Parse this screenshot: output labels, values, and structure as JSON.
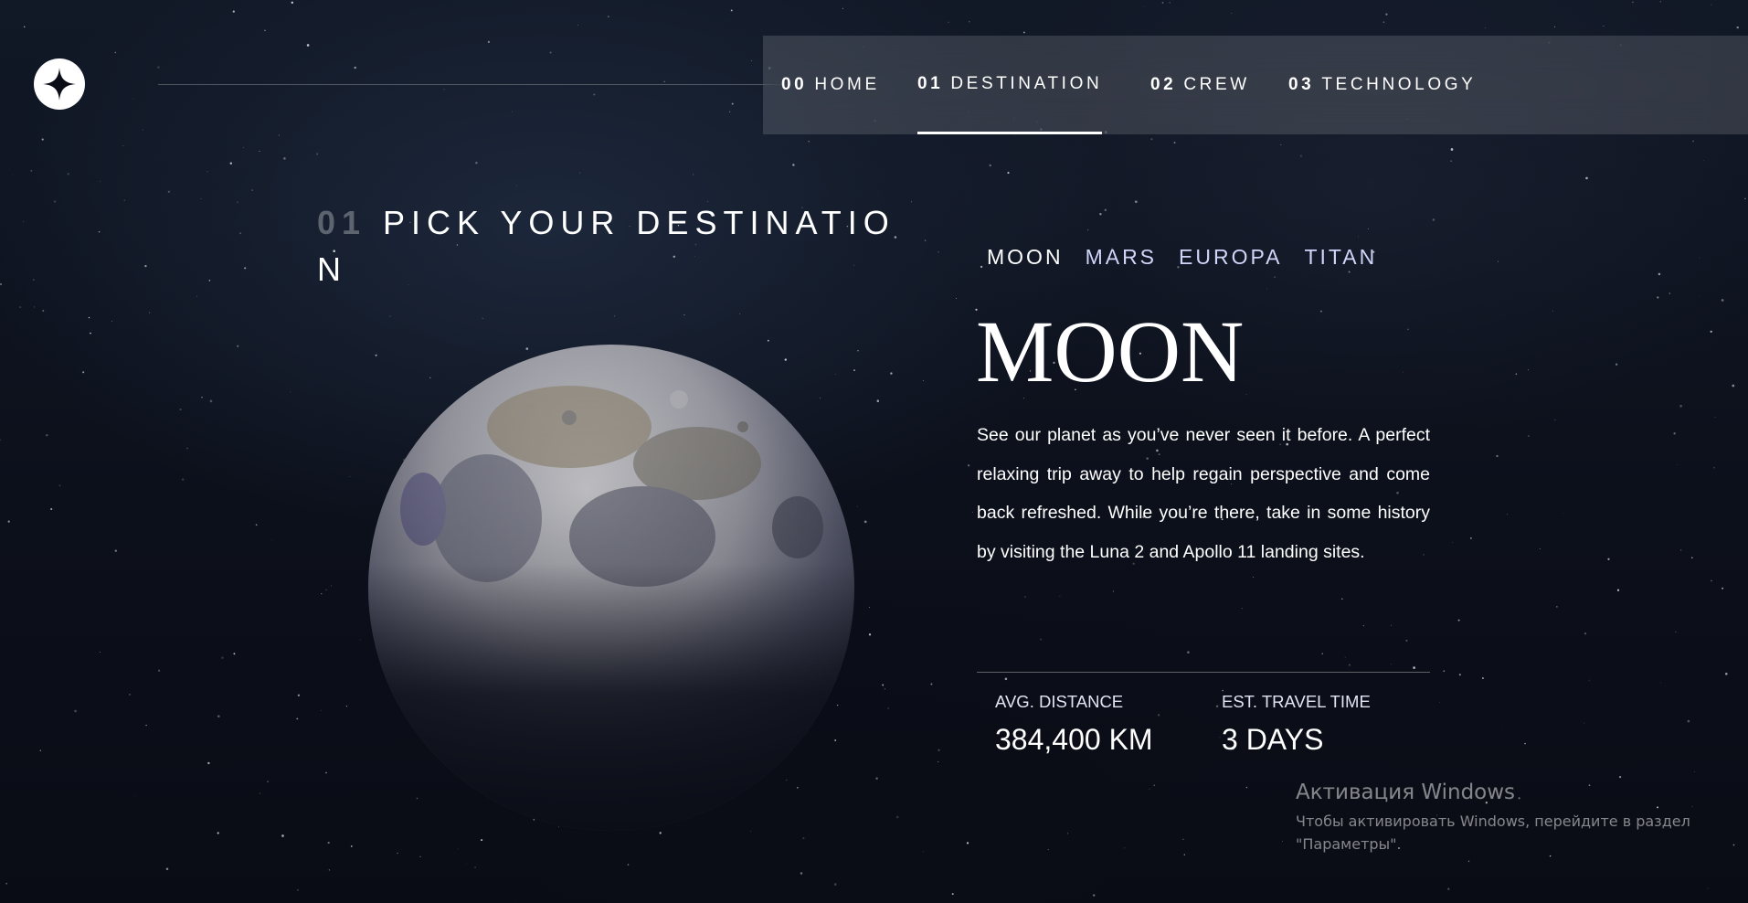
{
  "nav": {
    "items": [
      {
        "num": "00",
        "label": "HOME"
      },
      {
        "num": "01",
        "label": "DESTINATION"
      },
      {
        "num": "02",
        "label": "CREW"
      },
      {
        "num": "03",
        "label": "TECHNOLOGY"
      }
    ],
    "active": "DESTINATION"
  },
  "heading": {
    "num": "01",
    "text": "PICK YOUR DESTINATION"
  },
  "tabs": [
    "MOON",
    "MARS",
    "EUROPA",
    "TITAN"
  ],
  "active_tab": "MOON",
  "destination": {
    "name": "MOON",
    "description": "See our planet as you’ve never seen it before. A perfect relaxing trip away to help regain perspective and come back refreshed. While you’re there, take in some history by visiting the Luna 2 and Apollo 11 landing sites.",
    "stats": [
      {
        "label": "AVG. DISTANCE",
        "value": "384,400 KM"
      },
      {
        "label": "EST. TRAVEL TIME",
        "value": "3 DAYS"
      }
    ]
  },
  "windows_activation": {
    "title": "Активация Windows",
    "line1": "Чтобы активировать Windows, перейдите в раздел",
    "line2": "\"Параметры\"."
  },
  "icons": {
    "logo": "star-logo-icon"
  }
}
